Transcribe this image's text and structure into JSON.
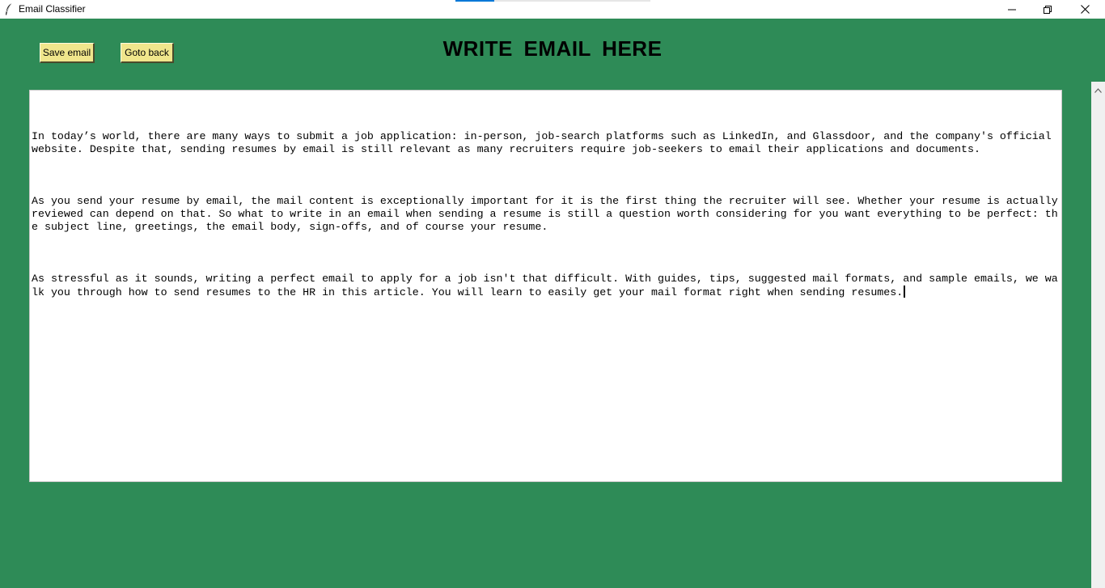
{
  "window": {
    "title": "Email Classifier",
    "icon": "feather-icon"
  },
  "window_controls": {
    "minimize_icon": "minimize-icon",
    "restore_icon": "restore-icon",
    "close_icon": "close-icon"
  },
  "toolbar": {
    "save_label": "Save email",
    "back_label": "Goto back"
  },
  "heading": "WRITE  EMAIL  HERE",
  "editor": {
    "paragraphs": [
      "In today’s world, there are many ways to submit a job application: in-person, job-search platforms such as LinkedIn, and Glassdoor, and the company's official website. Despite that, sending resumes by email is still relevant as many recruiters require job-seekers to email their applications and documents.",
      "As you send your resume by email, the mail content is exceptionally important for it is the first thing the recruiter will see. Whether your resume is actually reviewed can depend on that. So what to write in an email when sending a resume is still a question worth considering for you want everything to be perfect: the subject line, greetings, the email body, sign-offs, and of course your resume.",
      "As stressful as it sounds, writing a perfect email to apply for a job isn't that difficult. With guides, tips, suggested mail formats, and sample emails, we walk you through how to send resumes to the HR in this article. You will learn to easily get your mail format right when sending resumes."
    ]
  },
  "colors": {
    "background": "#2e8b57",
    "button": "#f0e68c",
    "editor_bg": "#ffffff"
  }
}
